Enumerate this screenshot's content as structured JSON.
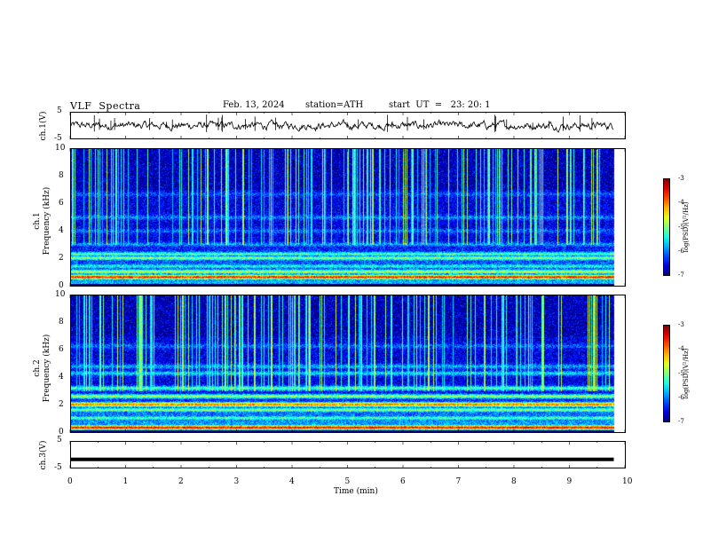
{
  "header": {
    "title": "VLF  Spectra",
    "date": "Feb. 13, 2024",
    "station": "station=ATH",
    "start": "start  UT  =   23: 20: 1"
  },
  "chart_data": [
    {
      "type": "line",
      "name": "ch1-waveform",
      "ylabel": "ch.1(V)",
      "yticks": [
        "5",
        "-5"
      ],
      "ylim": [
        -5,
        5
      ],
      "x_range_min": [
        0,
        9.8
      ],
      "level_approx": 0
    },
    {
      "type": "heatmap",
      "name": "ch1-spectrogram",
      "ylabel_line1": "ch.1",
      "ylabel_line2": "Frequency  (kHz)",
      "yticks": [
        "10",
        "8",
        "6",
        "4",
        "2",
        "0"
      ],
      "ylim_khz": [
        0,
        10
      ],
      "x_range_min": [
        0,
        9.8
      ],
      "colorbar": {
        "label": "log(PSD)(V²/Hz)",
        "ticks": [
          "-3",
          "-4",
          "-5",
          "-6",
          "-7"
        ],
        "range": [
          -7,
          -3
        ]
      },
      "bands_khz": [
        {
          "f": 0.6,
          "level": -3.6
        },
        {
          "f": 1.0,
          "level": -4.8
        },
        {
          "f": 1.4,
          "level": -5.4
        },
        {
          "f": 2.0,
          "level": -5.0
        },
        {
          "f": 2.3,
          "level": -5.2
        },
        {
          "f": 3.0,
          "level": -5.9
        },
        {
          "f": 4.0,
          "level": -6.1
        },
        {
          "f": 5.0,
          "level": -6.0
        },
        {
          "f": 6.7,
          "level": -6.2
        }
      ]
    },
    {
      "type": "heatmap",
      "name": "ch2-spectrogram",
      "ylabel_line1": "ch.2",
      "ylabel_line2": "Frequency  (kHz)",
      "yticks": [
        "10",
        "8",
        "6",
        "4",
        "2",
        "0"
      ],
      "ylim_khz": [
        0,
        10
      ],
      "x_range_min": [
        0,
        9.8
      ],
      "colorbar": {
        "label": "log(PSD)(V²/Hz)",
        "ticks": [
          "-3",
          "-4",
          "-5",
          "-6",
          "-7"
        ],
        "range": [
          -7,
          -3
        ]
      },
      "bands_khz": [
        {
          "f": 0.3,
          "level": -3.5
        },
        {
          "f": 1.0,
          "level": -5.2
        },
        {
          "f": 1.6,
          "level": -5.0
        },
        {
          "f": 2.0,
          "level": -4.0
        },
        {
          "f": 2.6,
          "level": -4.9
        },
        {
          "f": 3.2,
          "level": -5.2
        },
        {
          "f": 4.3,
          "level": -5.6
        },
        {
          "f": 4.8,
          "level": -5.8
        },
        {
          "f": 6.3,
          "level": -6.1
        }
      ]
    },
    {
      "type": "line",
      "name": "ch3-waveform",
      "ylabel": "ch.3(V)",
      "yticks": [
        "5",
        "-5"
      ],
      "ylim": [
        -5,
        5
      ],
      "x_range_min": [
        0,
        9.8
      ],
      "level": -1.7
    }
  ],
  "xaxis": {
    "label": "Time  (min)",
    "ticks": [
      "0",
      "1",
      "2",
      "3",
      "4",
      "5",
      "6",
      "7",
      "8",
      "9",
      "10"
    ],
    "range": [
      0,
      10
    ]
  }
}
